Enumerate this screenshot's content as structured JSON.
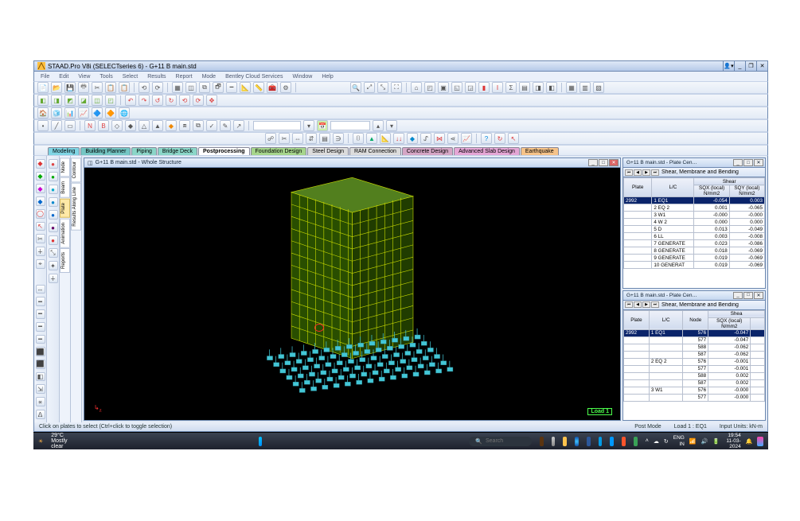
{
  "titlebar": {
    "app": "STAAD.Pro V8i (SELECTseries 6) - G+11 B main.std"
  },
  "menubar": [
    "File",
    "Edit",
    "View",
    "Tools",
    "Select",
    "Results",
    "Report",
    "Mode",
    "Bentley Cloud Services",
    "Window",
    "Help"
  ],
  "tabs": [
    {
      "label": "Modeling",
      "cls": "blue"
    },
    {
      "label": "Building Planner",
      "cls": "teal"
    },
    {
      "label": "Piping",
      "cls": "cyan"
    },
    {
      "label": "Bridge Deck",
      "cls": "cyan"
    },
    {
      "label": "Postprocessing",
      "cls": "active"
    },
    {
      "label": "Foundation Design",
      "cls": "green"
    },
    {
      "label": "Steel Design",
      "cls": "gray"
    },
    {
      "label": "RAM Connection",
      "cls": "gray"
    },
    {
      "label": "Concrete Design",
      "cls": "pink"
    },
    {
      "label": "Advanced Slab Design",
      "cls": "pink2"
    },
    {
      "label": "Earthquake",
      "cls": "orange"
    }
  ],
  "vtabs_left": [
    "Node",
    "Beam",
    "Plate",
    "Animation",
    "Reports"
  ],
  "vtabs_far": [
    "Contour",
    "Results Along Line"
  ],
  "doc": {
    "title": "G+11 B main.std - Whole Structure",
    "load_badge": "Load 1"
  },
  "panel1": {
    "caption": "G+11 B main.std - Plate Cen…",
    "nav_title": "Shear, Membrane and Bending",
    "group_header": "Shear",
    "cols": [
      "Plate",
      "L/C",
      "SQX (local)\nN/mm2",
      "SQY (local)\nN/mm2"
    ],
    "rows": [
      {
        "plate": "2992",
        "lc": "1 EQ1",
        "sqx": "-0.054",
        "sqy": "0.003",
        "sel": true
      },
      {
        "plate": "",
        "lc": "2 EQ 2",
        "sqx": "0.001",
        "sqy": "-0.065"
      },
      {
        "plate": "",
        "lc": "3 W1",
        "sqx": "-0.000",
        "sqy": "-0.000"
      },
      {
        "plate": "",
        "lc": "4 W 2",
        "sqx": "0.000",
        "sqy": "0.000"
      },
      {
        "plate": "",
        "lc": "5 D",
        "sqx": "0.013",
        "sqy": "-0.049"
      },
      {
        "plate": "",
        "lc": "6 LL",
        "sqx": "0.003",
        "sqy": "-0.008"
      },
      {
        "plate": "",
        "lc": "7 GENERATE",
        "sqx": "0.023",
        "sqy": "-0.086"
      },
      {
        "plate": "",
        "lc": "8 GENERATE",
        "sqx": "0.018",
        "sqy": "-0.069"
      },
      {
        "plate": "",
        "lc": "9 GENERATE",
        "sqx": "0.019",
        "sqy": "-0.069"
      },
      {
        "plate": "",
        "lc": "10 GENERAT",
        "sqx": "0.019",
        "sqy": "-0.069"
      }
    ]
  },
  "panel2": {
    "caption": "G+11 B main.std - Plate Cen…",
    "nav_title": "Shear, Membrane and Bending",
    "group_header": "Shea",
    "cols": [
      "Plate",
      "L/C",
      "Node",
      "SQX (local)\nN/mm2",
      ""
    ],
    "rows": [
      {
        "plate": "2992",
        "lc": "1 EQ1",
        "node": "576",
        "sqx": "-0.047",
        "sel": true
      },
      {
        "plate": "",
        "lc": "",
        "node": "577",
        "sqx": "-0.047"
      },
      {
        "plate": "",
        "lc": "",
        "node": "588",
        "sqx": "-0.062"
      },
      {
        "plate": "",
        "lc": "",
        "node": "587",
        "sqx": "-0.062"
      },
      {
        "plate": "",
        "lc": "2 EQ 2",
        "node": "576",
        "sqx": "-0.001"
      },
      {
        "plate": "",
        "lc": "",
        "node": "577",
        "sqx": "-0.001"
      },
      {
        "plate": "",
        "lc": "",
        "node": "588",
        "sqx": "0.002"
      },
      {
        "plate": "",
        "lc": "",
        "node": "587",
        "sqx": "0.002"
      },
      {
        "plate": "",
        "lc": "3 W1",
        "node": "576",
        "sqx": "-0.000"
      },
      {
        "plate": "",
        "lc": "",
        "node": "577",
        "sqx": "-0.000"
      }
    ]
  },
  "statusbar": {
    "hint": "Click on plates to select (Ctrl+click to toggle selection)",
    "mode": "Post Mode",
    "load": "Load 1 : EQ1",
    "units": "Input Units: kN-m"
  },
  "taskbar": {
    "weather_temp": "29°C",
    "weather_desc": "Mostly clear",
    "search_placeholder": "Search",
    "lang1": "ENG",
    "lang2": "IN",
    "time": "19:54",
    "date": "11-03-2024"
  }
}
